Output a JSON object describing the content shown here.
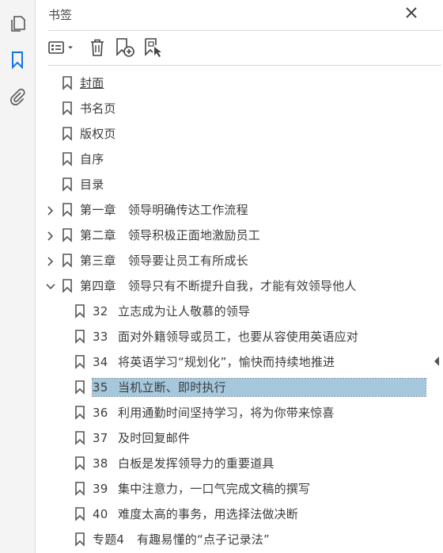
{
  "panel": {
    "title": "书签"
  },
  "rail": {
    "icons": [
      "pages-icon",
      "bookmarks-icon",
      "attachments-icon"
    ]
  },
  "toolbar": {
    "buttons": [
      "options-menu-icon",
      "delete-bookmark-icon",
      "new-bookmark-icon",
      "new-bookmark-from-structure-icon"
    ]
  },
  "bookmarks": [
    {
      "label": "封面",
      "level": 0,
      "expandable": false,
      "underline": true
    },
    {
      "label": "书名页",
      "level": 0,
      "expandable": false
    },
    {
      "label": "版权页",
      "level": 0,
      "expandable": false
    },
    {
      "label": "自序",
      "level": 0,
      "expandable": false
    },
    {
      "label": "目录",
      "level": 0,
      "expandable": false
    },
    {
      "label": "第一章　领导明确传达工作流程",
      "level": 0,
      "expandable": true,
      "expanded": false
    },
    {
      "label": "第二章　领导积极正面地激励员工",
      "level": 0,
      "expandable": true,
      "expanded": false
    },
    {
      "label": "第三章　领导要让员工有所成长",
      "level": 0,
      "expandable": true,
      "expanded": false
    },
    {
      "label": "第四章　领导只有不断提升自我，才能有效领导他人",
      "level": 0,
      "expandable": true,
      "expanded": true
    },
    {
      "num": "32",
      "label": "立志成为让人敬慕的领导",
      "level": 1
    },
    {
      "num": "33",
      "label": "面对外籍领导或员工，也要从容使用英语应对",
      "level": 1
    },
    {
      "num": "34",
      "label": "将英语学习“规划化”，愉快而持续地推进",
      "level": 1
    },
    {
      "num": "35",
      "label": "当机立断、即时执行",
      "level": 1,
      "selected": true
    },
    {
      "num": "36",
      "label": "利用通勤时间坚持学习，将为你带来惊喜",
      "level": 1
    },
    {
      "num": "37",
      "label": "及时回复邮件",
      "level": 1
    },
    {
      "num": "38",
      "label": "白板是发挥领导力的重要道具",
      "level": 1
    },
    {
      "num": "39",
      "label": "集中注意力，一口气完成文稿的撰写",
      "level": 1
    },
    {
      "num": "40",
      "label": "难度太高的事务，用选择法做决断",
      "level": 1
    },
    {
      "num": "专题4",
      "label": "有趣易懂的“点子记录法”",
      "level": 1
    }
  ],
  "colors": {
    "selection": "#a6c8dc",
    "accent": "#1473e6"
  }
}
